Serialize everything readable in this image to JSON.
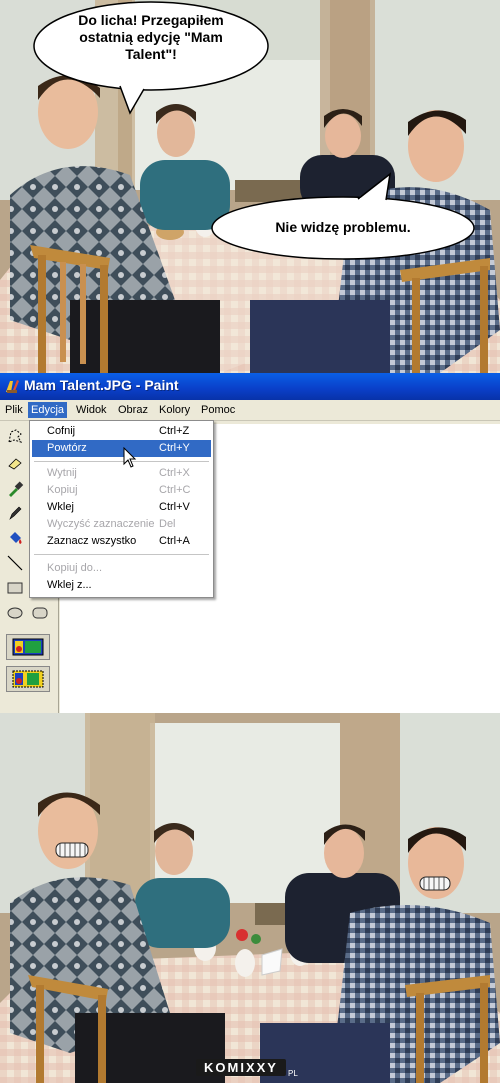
{
  "top_panel": {
    "bubble_left_text": "Do licha! Przegapiłem ostatnią edycję \"Mam Talent\"!",
    "bubble_left_lines": [
      "Do licha! Przegapiłem",
      "ostatnią edycję \"Mam",
      "Talent\"!"
    ],
    "bubble_right_text": "Nie widzę problemu."
  },
  "window": {
    "title": "Mam Talent.JPG - Paint"
  },
  "menu": {
    "items": [
      "Plik",
      "Edycja",
      "Widok",
      "Obraz",
      "Kolory",
      "Pomoc"
    ],
    "active": "Edycja"
  },
  "edit_menu": {
    "items": [
      {
        "label": "Cofnij",
        "shortcut": "Ctrl+Z",
        "enabled": true
      },
      {
        "label": "Powtórz",
        "shortcut": "Ctrl+Y",
        "enabled": true,
        "highlighted": true
      },
      {
        "label": "Wytnij",
        "shortcut": "Ctrl+X",
        "enabled": false
      },
      {
        "label": "Kopiuj",
        "shortcut": "Ctrl+C",
        "enabled": false
      },
      {
        "label": "Wklej",
        "shortcut": "Ctrl+V",
        "enabled": true
      },
      {
        "label": "Wyczyść zaznaczenie",
        "shortcut": "Del",
        "enabled": false
      },
      {
        "label": "Zaznacz wszystko",
        "shortcut": "Ctrl+A",
        "enabled": true
      },
      {
        "label": "Kopiuj do...",
        "shortcut": "",
        "enabled": false
      },
      {
        "label": "Wklej z...",
        "shortcut": "",
        "enabled": true
      }
    ]
  },
  "tools": [
    "free-select-icon",
    "eraser-icon",
    "color-picker-icon",
    "pencil-icon",
    "fill-icon",
    "line-icon",
    "rectangle-icon",
    "ellipse-icon",
    "rounded-rectangle-icon"
  ],
  "watermark": {
    "text": "KOMIXXY",
    "suffix": "PL"
  },
  "colors": {
    "titlebar": "#0a4fd6",
    "menu_highlight": "#316ac5",
    "chrome": "#ece9d8"
  }
}
